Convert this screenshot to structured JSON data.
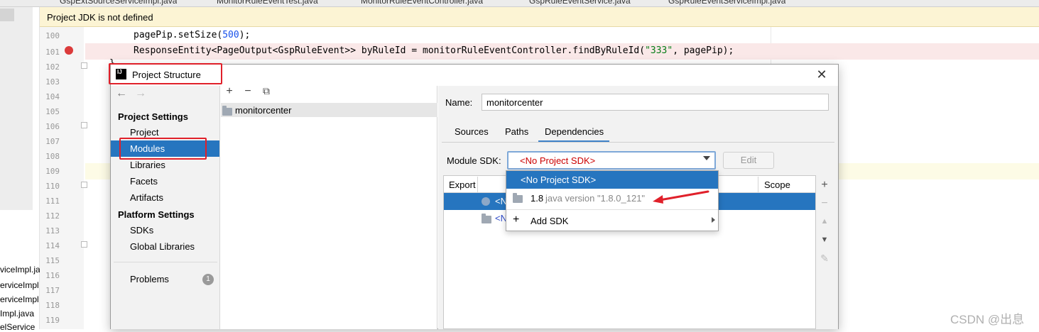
{
  "editor": {
    "tabs": [
      "GspExtSourceServiceImpl.java",
      "MonitorRuleEventTest.java",
      "MonitorRuleEventController.java",
      "GspRuleEventService.java",
      "GspRuleEventServiceImpl.java"
    ],
    "notice": "Project JDK is not defined",
    "line_numbers": [
      "100",
      "101",
      "102",
      "103",
      "104",
      "105",
      "106",
      "107",
      "108",
      "109",
      "110",
      "111",
      "112",
      "113",
      "114",
      "115",
      "116",
      "117",
      "118",
      "119"
    ],
    "code_line_100": {
      "pre": "pagePip.setSize(",
      "num": "500",
      "post": ");"
    },
    "code_line_101": {
      "pre": "ResponseEntity<PageOutput<GspRuleEvent>> byRuleId = monitorRuleEventController.findByRuleId(",
      "str": "\"333\"",
      "post": ", pagePip);"
    },
    "code_line_102": "}",
    "project_tree_files": [
      "viceImpl.ja",
      "erviceImpl",
      "erviceImpl",
      "Impl.java",
      "elService"
    ]
  },
  "dialog": {
    "title": "Project Structure",
    "logo_text": "IJ",
    "close": "✕",
    "nav_back": "←",
    "nav_forward": "→",
    "sidebar": {
      "project_settings_header": "Project Settings",
      "project_settings": [
        "Project",
        "Modules",
        "Libraries",
        "Facets",
        "Artifacts"
      ],
      "platform_settings_header": "Platform Settings",
      "platform_settings": [
        "SDKs",
        "Global Libraries"
      ],
      "problems_label": "Problems",
      "problems_count": "1",
      "selected": "Modules"
    },
    "module_toolbar": {
      "add": "+",
      "remove": "−",
      "copy": "⧉"
    },
    "module_name": "monitorcenter",
    "name_label": "Name:",
    "name_value": "monitorcenter",
    "tabs": [
      "Sources",
      "Paths",
      "Dependencies"
    ],
    "active_tab": "Dependencies",
    "module_sdk_label": "Module SDK:",
    "module_sdk_value": "<No Project SDK>",
    "edit_button": "Edit",
    "table": {
      "headers": {
        "export": "Export",
        "scope": "Scope"
      },
      "rows": [
        "<N",
        "<N"
      ]
    },
    "table_tools": {
      "add": "+",
      "remove": "−",
      "up": "▲",
      "down": "▼",
      "edit": "✎"
    }
  },
  "sdk_dropdown": {
    "selected": "<No Project SDK>",
    "jdk_version": "1.8",
    "jdk_desc": "java version \"1.8.0_121\"",
    "add_sdk": "Add SDK",
    "add_icon": "+"
  },
  "watermark": "CSDN @出息",
  "colors": {
    "selection": "#2675bf",
    "annotation_red": "#e0202a",
    "breakpoint": "#db3b3b",
    "notice_bg": "#fcf4d4"
  }
}
